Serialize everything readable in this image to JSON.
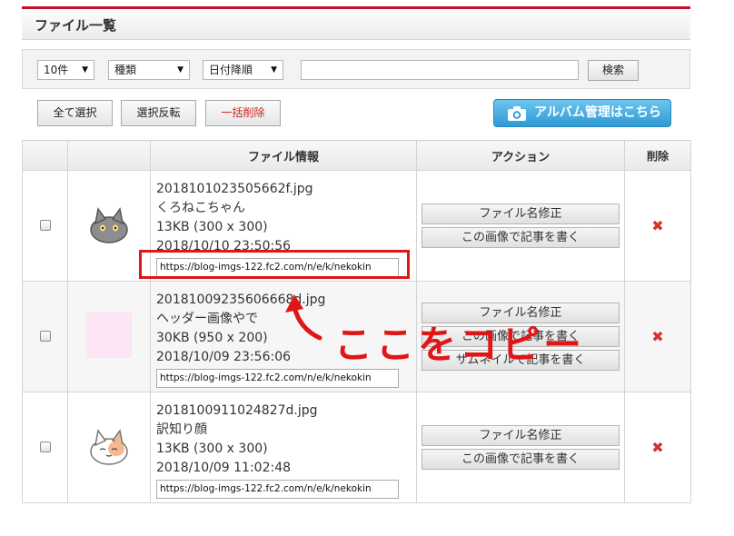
{
  "header": {
    "title": "ファイル一覧"
  },
  "filters": {
    "count": "10件",
    "type": "種類",
    "sort": "日付降順",
    "search_value": "",
    "search_label": "検索"
  },
  "toolbar": {
    "select_all": "全て選択",
    "invert": "選択反転",
    "bulk_delete": "一括削除",
    "album": "アルバム管理はこちら"
  },
  "table": {
    "headers": [
      "",
      "",
      "ファイル情報",
      "アクション",
      "削除"
    ],
    "rows": [
      {
        "filename": "2018101023505662f.jpg",
        "title": "くろねこちゃん",
        "size": "13KB (300 x 300)",
        "date": "2018/10/10 23:50:56",
        "url": "https://blog-imgs-122.fc2.com/n/e/k/nekokin",
        "actions": [
          "ファイル名修正",
          "この画像で記事を書く"
        ]
      },
      {
        "filename": "20181009235606668d.jpg",
        "title": "ヘッダー画像やで",
        "size": "30KB (950 x 200)",
        "date": "2018/10/09 23:56:06",
        "url": "https://blog-imgs-122.fc2.com/n/e/k/nekokin",
        "actions": [
          "ファイル名修正",
          "この画像で記事を書く",
          "サムネイルで記事を書く"
        ]
      },
      {
        "filename": "2018100911024827d.jpg",
        "title": "訳知り顔",
        "size": "13KB (300 x 300)",
        "date": "2018/10/09 11:02:48",
        "url": "https://blog-imgs-122.fc2.com/n/e/k/nekokin",
        "actions": [
          "ファイル名修正",
          "この画像で記事を書く"
        ]
      }
    ],
    "delete_icon": "close-icon"
  },
  "annotation": {
    "text": "ここをコピー"
  },
  "colors": {
    "accent_red": "#e01616",
    "header_border": "#c8102e",
    "album_blue": "#2f9ad4",
    "delete_red": "#d4322c"
  }
}
